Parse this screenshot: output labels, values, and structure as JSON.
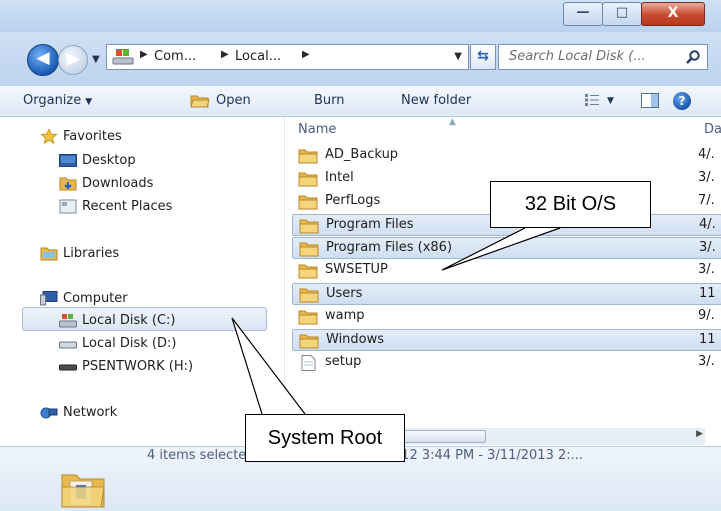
{
  "window": {
    "min_glyph": "—",
    "max_glyph": "□",
    "close_glyph": "X"
  },
  "nav": {
    "back_glyph": "◀",
    "forward_glyph": "▶",
    "breadcrumb": [
      "Com...",
      "Local..."
    ],
    "search_placeholder": "Search Local Disk (..."
  },
  "toolbar": {
    "organize": "Organize",
    "open": "Open",
    "burn": "Burn",
    "new_folder": "New folder"
  },
  "sidebar": {
    "favorites": {
      "label": "Favorites",
      "items": [
        "Desktop",
        "Downloads",
        "Recent Places"
      ]
    },
    "libraries": "Libraries",
    "computer": {
      "label": "Computer",
      "items": [
        "Local Disk (C:)",
        "Local Disk (D:)",
        "PSENTWORK (H:)"
      ]
    },
    "network": "Network",
    "selected_item": "Local Disk (C:)"
  },
  "filelist": {
    "columns": {
      "name": "Name",
      "date": "Da"
    },
    "rows": [
      {
        "name": "AD_Backup",
        "date": "4/.",
        "selected": false,
        "type": "folder"
      },
      {
        "name": "Intel",
        "date": "3/.",
        "selected": false,
        "type": "folder"
      },
      {
        "name": "PerfLogs",
        "date": "7/.",
        "selected": false,
        "type": "folder"
      },
      {
        "name": "Program Files",
        "date": "4/.",
        "selected": true,
        "type": "folder"
      },
      {
        "name": "Program Files (x86)",
        "date": "3/.",
        "selected": true,
        "type": "folder"
      },
      {
        "name": "SWSETUP",
        "date": "3/.",
        "selected": false,
        "type": "folder"
      },
      {
        "name": "Users",
        "date": "11",
        "selected": true,
        "type": "folder"
      },
      {
        "name": "wamp",
        "date": "9/.",
        "selected": false,
        "type": "folder"
      },
      {
        "name": "Windows",
        "date": "11",
        "selected": true,
        "type": "folder"
      },
      {
        "name": "setup",
        "date": "3/.",
        "selected": false,
        "type": "file"
      }
    ]
  },
  "details": {
    "summary": "4 items selected  Date modified: 4/2/2012 3:44 PM - 3/11/2013 2:..."
  },
  "annotations": {
    "callout_32bit": "32 Bit O/S",
    "callout_root": "System Root"
  },
  "colors": {
    "selection": "#cfdef1",
    "folder": "#e8b94a",
    "title_blue": "#b9d2ee",
    "close_red": "#c74a2f"
  }
}
